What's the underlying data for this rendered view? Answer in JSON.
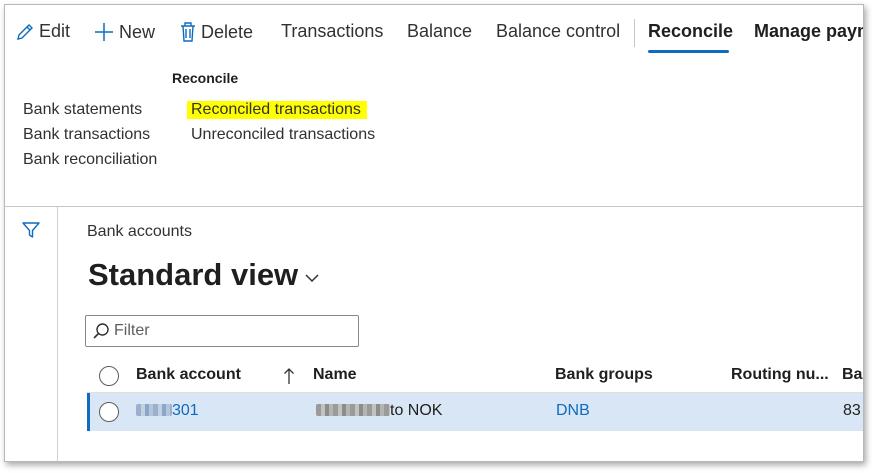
{
  "toolbar": {
    "edit": "Edit",
    "new": "New",
    "delete": "Delete",
    "transactions": "Transactions",
    "balance": "Balance",
    "balance_control": "Balance control",
    "reconcile": "Reconcile",
    "manage_payments": "Manage paym"
  },
  "panel": {
    "group_title": "Reconcile",
    "left_links": [
      "Bank statements",
      "Bank transactions",
      "Bank reconciliation"
    ],
    "right_links": [
      "Reconciled transactions",
      "Unreconciled transactions"
    ]
  },
  "main": {
    "breadcrumb": "Bank accounts",
    "view_title": "Standard view",
    "filter_placeholder": "Filter"
  },
  "grid": {
    "headers": [
      "Bank account",
      "Name",
      "Bank groups",
      "Routing nu...",
      "Ba"
    ],
    "rows": [
      {
        "bank_account_suffix": "301",
        "name_suffix": "to NOK",
        "bank_groups": "DNB",
        "next_col": "83"
      }
    ]
  },
  "colors": {
    "accent": "#0f6cbd",
    "highlight": "#ffff00",
    "selected_row": "#d9e6f5"
  }
}
